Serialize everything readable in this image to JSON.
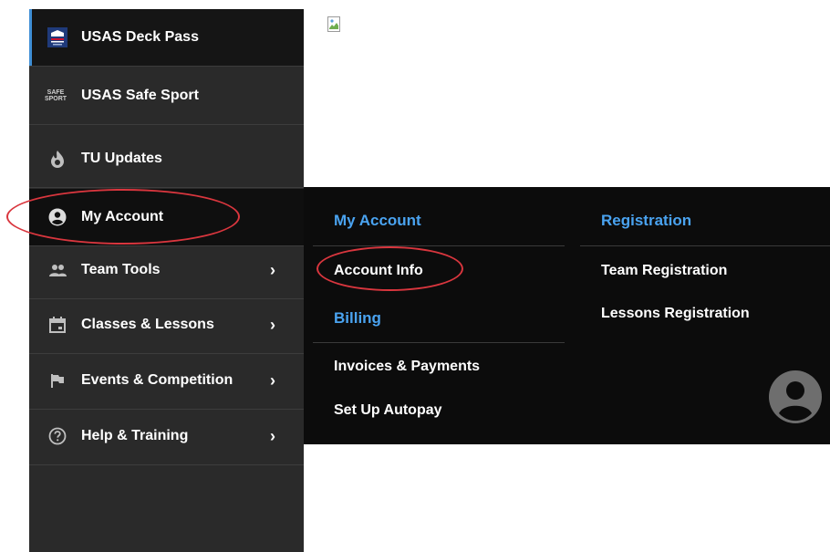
{
  "sidebar": {
    "items": [
      {
        "label": "USAS Deck Pass",
        "icon": "usas-logo-icon"
      },
      {
        "label": "USAS Safe Sport",
        "icon": "safe-sport-logo-icon",
        "logo_text": "SAFE SPORT"
      },
      {
        "label": "TU Updates",
        "icon": "flame-icon"
      },
      {
        "label": "My Account",
        "icon": "account-circle-icon"
      },
      {
        "label": "Team Tools",
        "icon": "people-icon"
      },
      {
        "label": "Classes & Lessons",
        "icon": "calendar-icon"
      },
      {
        "label": "Events & Competition",
        "icon": "flag-icon"
      },
      {
        "label": "Help & Training",
        "icon": "help-circle-icon"
      }
    ],
    "chevron": "›"
  },
  "menu": {
    "my_account_heading": "My Account",
    "account_info": "Account Info",
    "billing_heading": "Billing",
    "invoices": "Invoices & Payments",
    "autopay": "Set Up Autopay",
    "registration_heading": "Registration",
    "team_registration": "Team Registration",
    "lessons_registration": "Lessons Registration"
  },
  "colors": {
    "accent": "#4aa3f0",
    "sidebar_bg": "#2a2a2a",
    "menu_bg": "#0c0c0c",
    "annotation": "#d9363e"
  }
}
